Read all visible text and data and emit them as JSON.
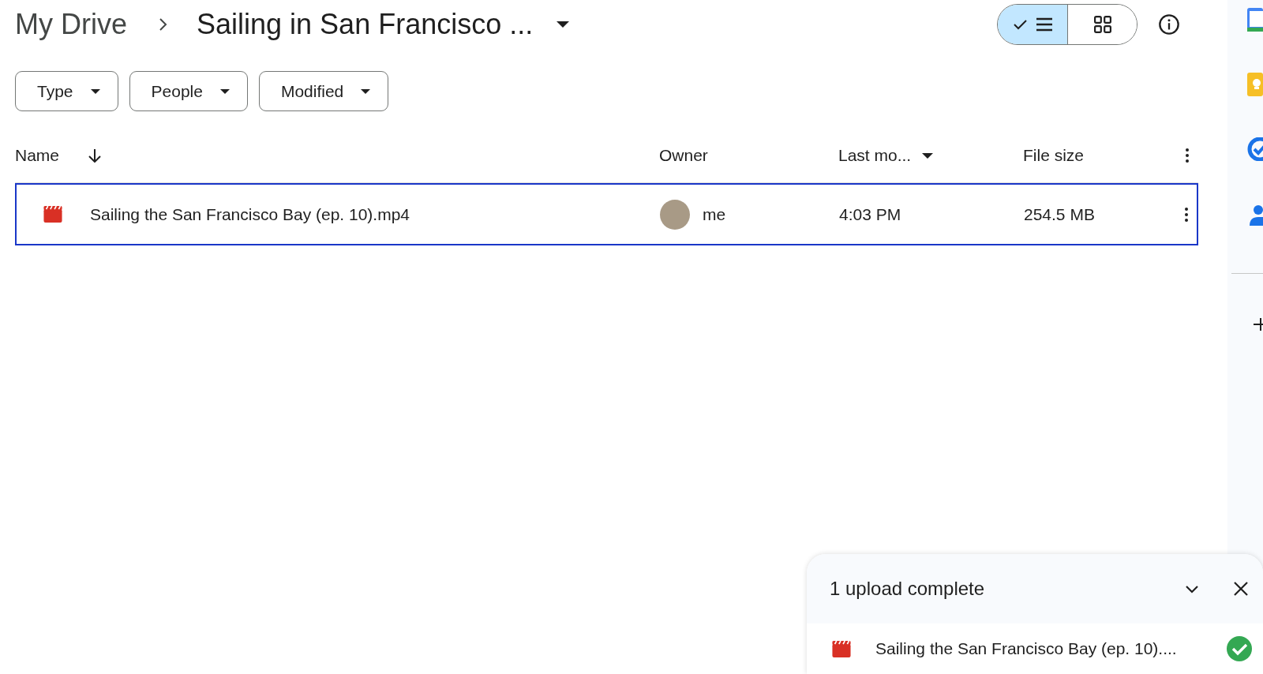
{
  "breadcrumb": [
    {
      "label": "My Drive",
      "kind": "root"
    },
    {
      "label": "Sailing in San Francisco ...",
      "kind": "current"
    }
  ],
  "view_toggle": [
    {
      "kind": "list",
      "selected": true
    },
    {
      "kind": "grid",
      "selected": false
    }
  ],
  "filters": [
    {
      "label": "Type"
    },
    {
      "label": "People"
    },
    {
      "label": "Modified"
    }
  ],
  "table": {
    "columns": [
      {
        "label": "Name",
        "kind": "arrow"
      },
      {
        "label": "Owner",
        "kind": "plain"
      },
      {
        "label": "Last mo...",
        "kind": "caret"
      },
      {
        "label": "File size",
        "kind": "plain"
      }
    ],
    "rows": [
      {
        "name": "Sailing the San Francisco Bay (ep. 10).mp4",
        "owner": "me",
        "modified": "4:03 PM",
        "size": "254.5 MB",
        "selected": true
      }
    ]
  },
  "upload_panel": {
    "title": "1 upload complete",
    "items": [
      {
        "name": "Sailing the San Francisco Bay (ep. 10)....",
        "done": true
      }
    ]
  }
}
